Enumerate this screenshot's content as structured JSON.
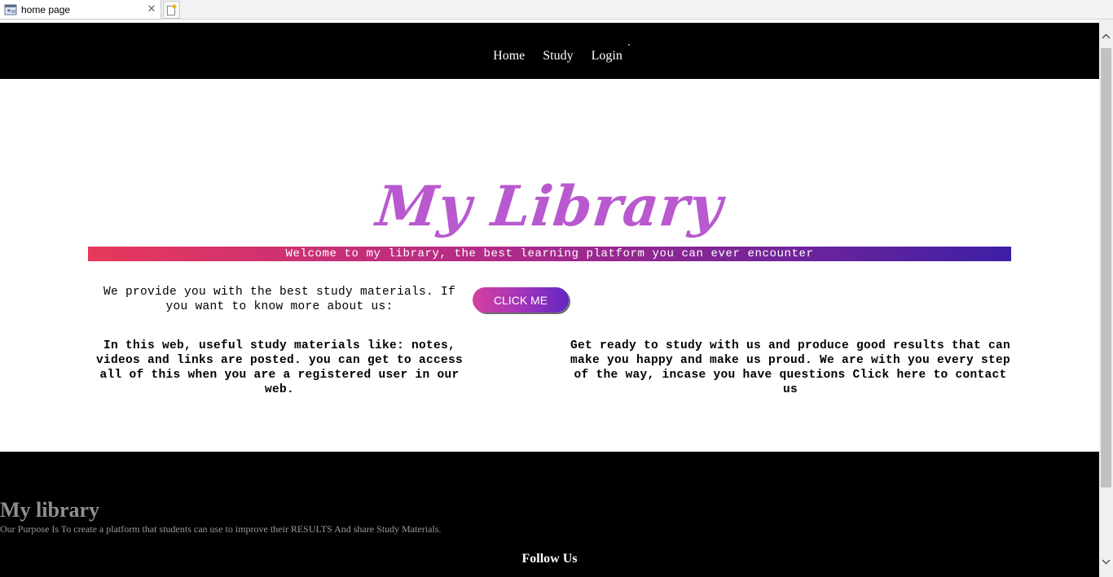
{
  "browser": {
    "tab_title": "home page"
  },
  "nav": {
    "items": [
      {
        "label": "Home"
      },
      {
        "label": "Study"
      },
      {
        "label": "Login"
      }
    ]
  },
  "hero": {
    "title": "My Library",
    "welcome": "Welcome to my library, the best learning platform you can ever encounter",
    "provide_text": "We provide you with the best study materials. If you want to know more about us:",
    "button_label": "CLICK ME"
  },
  "columns": {
    "left": "In this web, useful study materials like: notes, videos and links are posted. you can get to access all of this when you are a registered user in our web.",
    "right": "Get ready to study with us and produce good results that can make you happy and make us proud. We are with you every step of the way, incase you have questions Click here to contact us"
  },
  "footer": {
    "title": "My library",
    "description": "Our Purpose Is To create a platform that students can use to improve their RESULTS And share Study Materials.",
    "follow_us": "Follow Us"
  },
  "colors": {
    "navbar": "#000000",
    "title": "#b959cf",
    "gradient_start": "#e8385b",
    "gradient_end": "#3d1fa6"
  }
}
